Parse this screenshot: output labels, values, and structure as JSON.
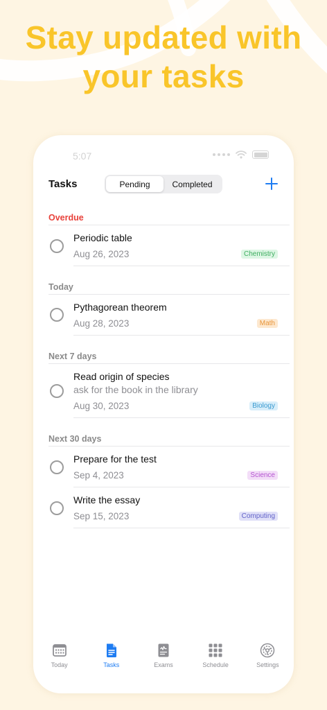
{
  "headline": {
    "line1": "Stay updated with",
    "line2": "your tasks"
  },
  "status_bar": {
    "time": "5:07"
  },
  "nav": {
    "title": "Tasks",
    "segments": [
      "Pending",
      "Completed"
    ],
    "active_segment": "Pending",
    "add_icon": "plus-icon"
  },
  "sections": [
    {
      "header": "Overdue",
      "tasks": [
        {
          "title": "Periodic table",
          "date": "Aug 26, 2023",
          "tag": "Chemistry"
        }
      ]
    },
    {
      "header": "Today",
      "tasks": [
        {
          "title": "Pythagorean theorem",
          "date": "Aug 28, 2023",
          "tag": "Math"
        }
      ]
    },
    {
      "header": "Next 7 days",
      "tasks": [
        {
          "title": "Read origin of species",
          "note": "ask for the book in the library",
          "date": "Aug 30, 2023",
          "tag": "Biology"
        }
      ]
    },
    {
      "header": "Next 30 days",
      "tasks": [
        {
          "title": "Prepare for the test",
          "date": "Sep 4, 2023",
          "tag": "Science"
        },
        {
          "title": "Write the essay",
          "date": "Sep 15, 2023",
          "tag": "Computing"
        }
      ]
    }
  ],
  "tag_colors": {
    "Chemistry": {
      "bg": "#DDF6E4",
      "fg": "#3FAE61"
    },
    "Math": {
      "bg": "#FDE8CF",
      "fg": "#E8963A"
    },
    "Biology": {
      "bg": "#D8EEFA",
      "fg": "#3A9BD0"
    },
    "Science": {
      "bg": "#F3DDF8",
      "fg": "#B453D0"
    },
    "Computing": {
      "bg": "#E0E0F8",
      "fg": "#6263C9"
    }
  },
  "tabbar": {
    "active": "Tasks",
    "items": [
      {
        "label": "Today",
        "icon": "calendar-icon"
      },
      {
        "label": "Tasks",
        "icon": "document-icon"
      },
      {
        "label": "Exams",
        "icon": "exam-icon"
      },
      {
        "label": "Schedule",
        "icon": "grid-icon"
      },
      {
        "label": "Settings",
        "icon": "gear-icon"
      }
    ]
  },
  "colors": {
    "background": "#FEF5E3",
    "headline": "#F9C52A",
    "accent": "#1E7CF2",
    "overdue": "#E8413A"
  }
}
